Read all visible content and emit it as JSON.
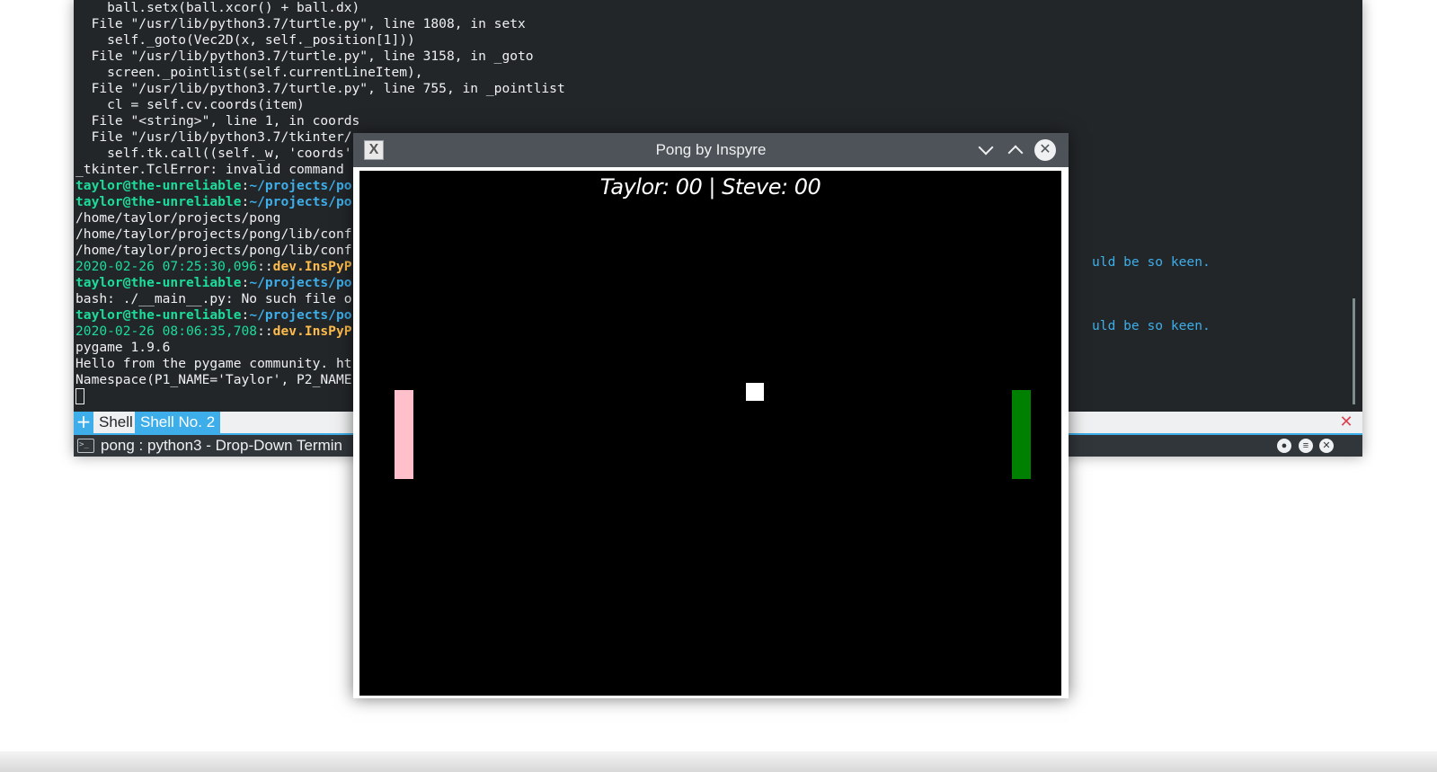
{
  "terminal": {
    "output": [
      {
        "segments": [
          {
            "t": "    ball.setx(ball.xcor() + ball.dx)",
            "c": ""
          }
        ]
      },
      {
        "segments": [
          {
            "t": "  File \"/usr/lib/python3.7/turtle.py\", line 1808, in setx",
            "c": ""
          }
        ]
      },
      {
        "segments": [
          {
            "t": "    self._goto(Vec2D(x, self._position[1]))",
            "c": ""
          }
        ]
      },
      {
        "segments": [
          {
            "t": "  File \"/usr/lib/python3.7/turtle.py\", line 3158, in _goto",
            "c": ""
          }
        ]
      },
      {
        "segments": [
          {
            "t": "    screen._pointlist(self.currentLineItem),",
            "c": ""
          }
        ]
      },
      {
        "segments": [
          {
            "t": "  File \"/usr/lib/python3.7/turtle.py\", line 755, in _pointlist",
            "c": ""
          }
        ]
      },
      {
        "segments": [
          {
            "t": "    cl = self.cv.coords(item)",
            "c": ""
          }
        ]
      },
      {
        "segments": [
          {
            "t": "  File \"<string>\", line 1, in coords",
            "c": ""
          }
        ]
      },
      {
        "segments": [
          {
            "t": "  File \"/usr/lib/python3.7/tkinter/",
            "c": ""
          }
        ]
      },
      {
        "segments": [
          {
            "t": "    self.tk.call((self._w, 'coords'",
            "c": ""
          }
        ]
      },
      {
        "segments": [
          {
            "t": "_tkinter.TclError: invalid command ",
            "c": ""
          }
        ]
      },
      {
        "segments": [
          {
            "t": "taylor@the-unreliable",
            "c": "c-user"
          },
          {
            "t": ":",
            "c": ""
          },
          {
            "t": "~/projects/po",
            "c": "c-path"
          }
        ]
      },
      {
        "segments": [
          {
            "t": "taylor@the-unreliable",
            "c": "c-user"
          },
          {
            "t": ":",
            "c": ""
          },
          {
            "t": "~/projects/po",
            "c": "c-path"
          }
        ]
      },
      {
        "segments": [
          {
            "t": "/home/taylor/projects/pong",
            "c": ""
          }
        ]
      },
      {
        "segments": [
          {
            "t": "/home/taylor/projects/pong/lib/conf",
            "c": ""
          }
        ]
      },
      {
        "segments": [
          {
            "t": "/home/taylor/projects/pong/lib/conf",
            "c": ""
          }
        ]
      },
      {
        "segments": [
          {
            "t": "2020-02-26 07:25:30,096",
            "c": "c-time"
          },
          {
            "t": "::",
            "c": ""
          },
          {
            "t": "dev.InsPyP",
            "c": "c-mod"
          }
        ]
      },
      {
        "segments": [
          {
            "t": "taylor@the-unreliable",
            "c": "c-user"
          },
          {
            "t": ":",
            "c": ""
          },
          {
            "t": "~/projects/po",
            "c": "c-path"
          }
        ]
      },
      {
        "segments": [
          {
            "t": "bash: ./__main__.py: No such file o",
            "c": ""
          }
        ]
      },
      {
        "segments": [
          {
            "t": "taylor@the-unreliable",
            "c": "c-user"
          },
          {
            "t": ":",
            "c": ""
          },
          {
            "t": "~/projects/po",
            "c": "c-path"
          }
        ]
      },
      {
        "segments": [
          {
            "t": "2020-02-26 08:06:35,708",
            "c": "c-time"
          },
          {
            "t": "::",
            "c": ""
          },
          {
            "t": "dev.InsPyP",
            "c": "c-mod"
          }
        ]
      },
      {
        "segments": [
          {
            "t": "pygame 1.9.6",
            "c": ""
          }
        ]
      },
      {
        "segments": [
          {
            "t": "Hello from the pygame community. ht",
            "c": ""
          }
        ]
      },
      {
        "segments": [
          {
            "t": "Namespace(P1_NAME='Taylor', P2_NAME",
            "c": ""
          }
        ]
      }
    ],
    "right_messages": [
      "uld be so keen.",
      "uld be so keen."
    ],
    "tabs": {
      "add_symbol": "+",
      "tab1": "Shell",
      "tab2": "Shell No. 2",
      "close_symbol": "✕"
    },
    "status_title": "pong : python3 - Drop-Down Termin",
    "status_icon_text": ">_"
  },
  "pong": {
    "title": "Pong by Inspyre",
    "icon_letter": "X",
    "close_symbol": "✕",
    "score": "Taylor: 00 | Steve: 00",
    "colors": {
      "left_paddle": "#ffc0cb",
      "right_paddle": "#008000",
      "ball": "#ffffff",
      "background": "#000000"
    }
  }
}
